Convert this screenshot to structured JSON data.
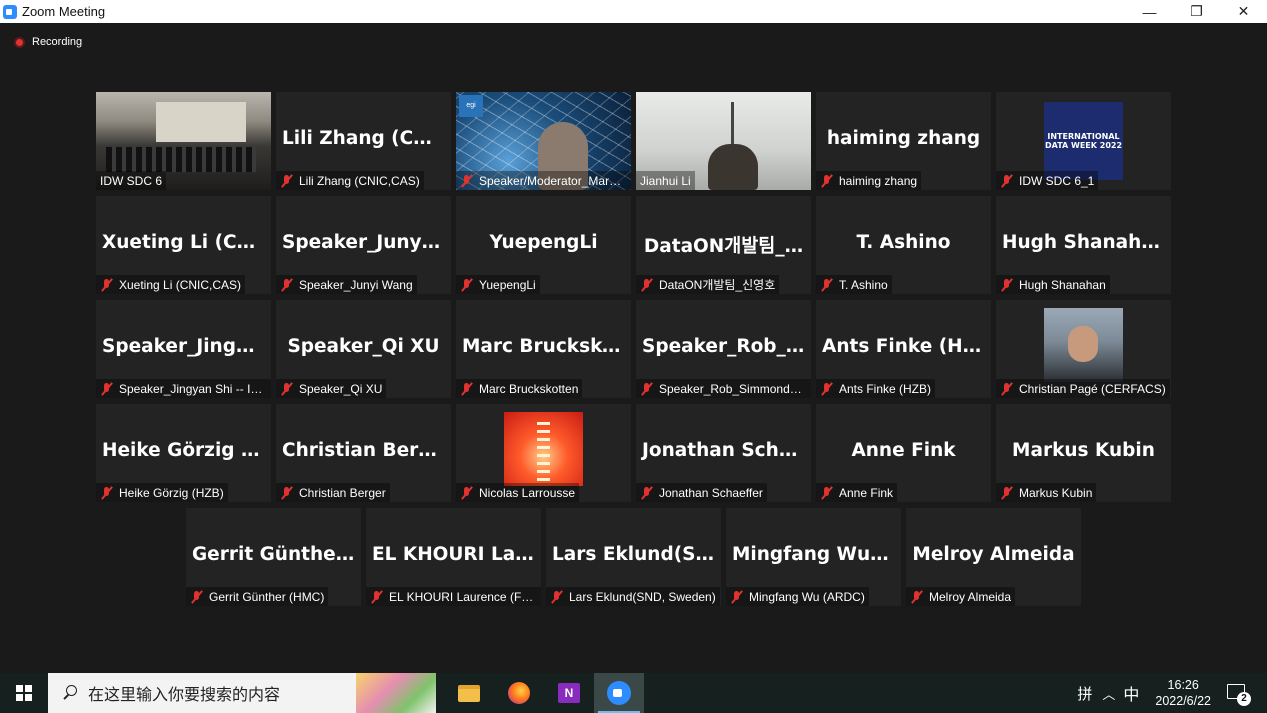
{
  "window": {
    "title": "Zoom Meeting",
    "minimize": "—",
    "restore": "❐",
    "close": "✕"
  },
  "recording": {
    "label": "Recording",
    "color": "#e0322f"
  },
  "active_speaker_color": "#d9e83c",
  "participants": [
    {
      "label": "IDW SDC 6",
      "big": "",
      "video": "room",
      "muted": false
    },
    {
      "label": "Lili Zhang (CNIC,CAS)",
      "big": "Lili Zhang (CNI…",
      "muted": true
    },
    {
      "label": "Speaker/Moderator_Mark…",
      "big": "",
      "video": "net",
      "muted": true,
      "logo": "egi"
    },
    {
      "label": "Jianhui Li",
      "big": "",
      "video": "office",
      "muted": false,
      "active": true
    },
    {
      "label": "haiming zhang",
      "big": "haiming zhang",
      "muted": true
    },
    {
      "label": "IDW SDC 6_1",
      "big": "",
      "video": "idw",
      "muted": true,
      "logo_text": "INTERNATIONAL DATA WEEK 2022"
    },
    {
      "label": "Xueting Li (CNIC,CAS)",
      "big": "Xueting Li (CNI…",
      "muted": true
    },
    {
      "label": "Speaker_Junyi Wang",
      "big": "Speaker_Junyi…",
      "muted": true
    },
    {
      "label": "YuepengLi",
      "big": "YuepengLi",
      "muted": true
    },
    {
      "label": "DataON개발팀_신영호",
      "big": "DataON개발팀_…",
      "muted": true
    },
    {
      "label": "T. Ashino",
      "big": "T. Ashino",
      "muted": true
    },
    {
      "label": "Hugh Shanahan",
      "big": "Hugh Shanahan",
      "muted": true
    },
    {
      "label": "Speaker_Jingyan Shi -- IH…",
      "big": "Speaker_Jingya…",
      "muted": true
    },
    {
      "label": "Speaker_Qi XU",
      "big": "Speaker_Qi XU",
      "muted": true
    },
    {
      "label": "Marc Bruckskotten",
      "big": "Marc Bruckskot…",
      "muted": true
    },
    {
      "label": "Speaker_Rob_Simmonds (…",
      "big": "Speaker_Rob_Si…",
      "muted": true
    },
    {
      "label": "Ants Finke (HZB)",
      "big": "Ants Finke (HZB)",
      "muted": true
    },
    {
      "label": "Christian Pagé (CERFACS)",
      "big": "",
      "video": "face",
      "muted": true
    },
    {
      "label": "Heike Görzig (HZB)",
      "big": "Heike Görzig (H…",
      "muted": true
    },
    {
      "label": "Christian Berger",
      "big": "Christian Berger",
      "muted": true
    },
    {
      "label": "Nicolas Larrousse",
      "big": "",
      "video": "tower",
      "muted": true
    },
    {
      "label": "Jonathan Schaeffer",
      "big": "Jonathan Schae…",
      "muted": true
    },
    {
      "label": "Anne Fink",
      "big": "Anne Fink",
      "muted": true
    },
    {
      "label": "Markus Kubin",
      "big": "Markus Kubin",
      "muted": true
    },
    {
      "label": "Gerrit Günther (HMC)",
      "big": "Gerrit Günther (…",
      "muted": true
    },
    {
      "label": "EL KHOURI Laurence (FR …",
      "big": "EL KHOURI Laur…",
      "muted": true
    },
    {
      "label": "Lars Eklund(SND, Sweden)",
      "big": "Lars Eklund(SN…",
      "muted": true
    },
    {
      "label": "Mingfang Wu (ARDC)",
      "big": "Mingfang Wu (…",
      "muted": true
    },
    {
      "label": "Melroy Almeida",
      "big": "Melroy Almeida",
      "muted": true
    }
  ],
  "taskbar": {
    "search_placeholder": "在这里输入你要搜索的内容",
    "ime_icon": "拼",
    "chevron": "︿",
    "lang": "中",
    "time": "16:26",
    "date": "2022/6/22",
    "notification_count": "2",
    "apps": [
      {
        "name": "file-explorer"
      },
      {
        "name": "firefox"
      },
      {
        "name": "onenote",
        "glyph": "N"
      },
      {
        "name": "zoom",
        "active": true
      }
    ]
  }
}
